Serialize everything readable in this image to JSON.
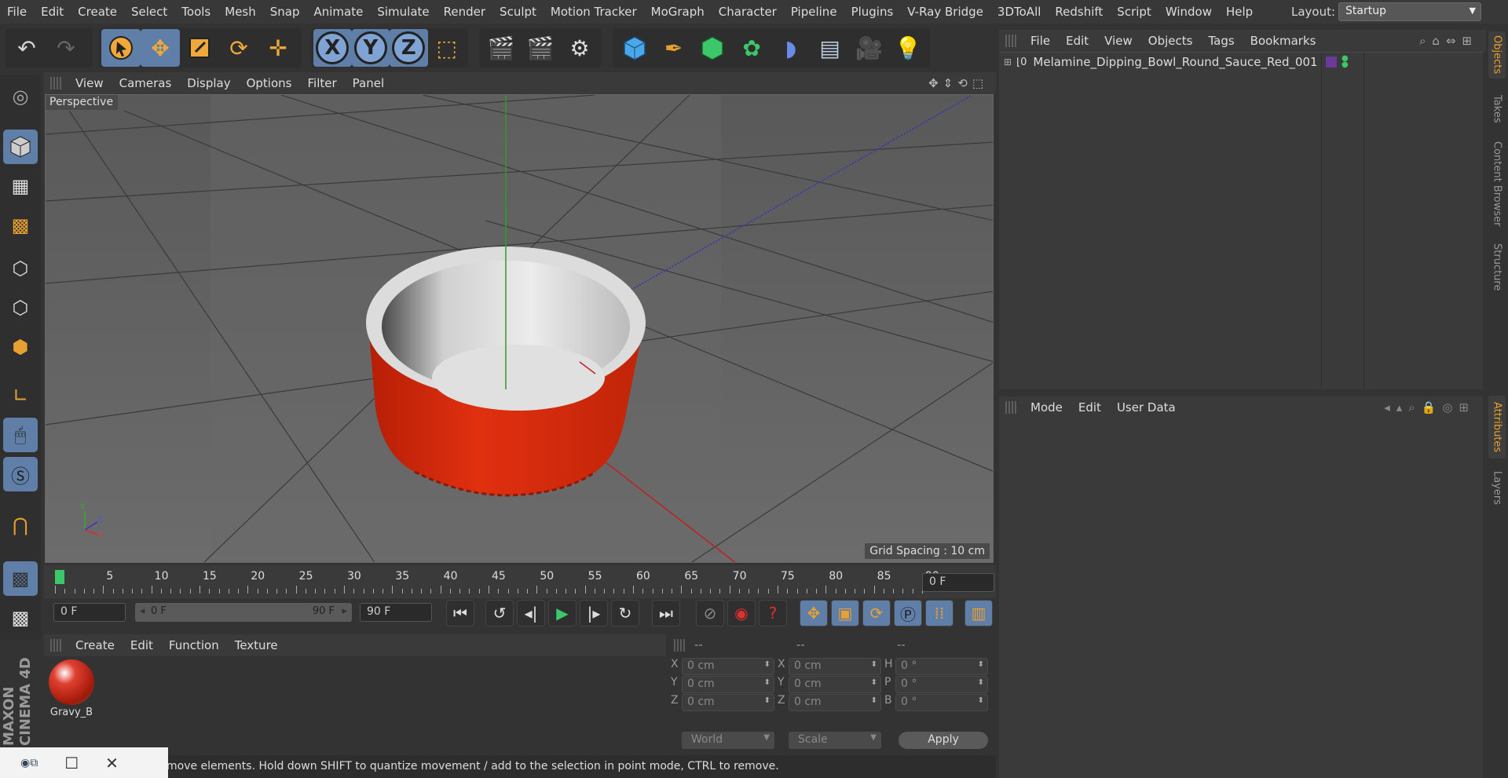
{
  "menubar": {
    "items": [
      "File",
      "Edit",
      "Create",
      "Select",
      "Tools",
      "Mesh",
      "Snap",
      "Animate",
      "Simulate",
      "Render",
      "Sculpt",
      "Motion Tracker",
      "MoGraph",
      "Character",
      "Pipeline",
      "Plugins",
      "V-Ray Bridge",
      "3DToAll",
      "Redshift",
      "Script",
      "Window",
      "Help"
    ],
    "layout_label": "Layout:",
    "layout_value": "Startup"
  },
  "viewport": {
    "menu": [
      "View",
      "Cameras",
      "Display",
      "Options",
      "Filter",
      "Panel"
    ],
    "label": "Perspective",
    "grid_spacing": "Grid Spacing : 10 cm",
    "axis_y": "Y",
    "axis_z": "Z",
    "axis_x": "X"
  },
  "timeline": {
    "ticks": [
      "0",
      "5",
      "10",
      "15",
      "20",
      "25",
      "30",
      "35",
      "40",
      "45",
      "50",
      "55",
      "60",
      "65",
      "70",
      "75",
      "80",
      "85",
      "90"
    ],
    "current_frame": "0 F",
    "start_frame": "0 F",
    "range_start": "0 F",
    "range_end": "90 F",
    "end_frame": "90 F"
  },
  "materials": {
    "menu": [
      "Create",
      "Edit",
      "Function",
      "Texture"
    ],
    "items": [
      {
        "name": "Gravy_B"
      }
    ]
  },
  "coordinates": {
    "headers": [
      "--",
      "--",
      "--"
    ],
    "rows": [
      {
        "a": "X",
        "v1": "0 cm",
        "b": "X",
        "v2": "0 cm",
        "c": "H",
        "v3": "0 °"
      },
      {
        "a": "Y",
        "v1": "0 cm",
        "b": "Y",
        "v2": "0 cm",
        "c": "P",
        "v3": "0 °"
      },
      {
        "a": "Z",
        "v1": "0 cm",
        "b": "Z",
        "v2": "0 cm",
        "c": "B",
        "v3": "0 °"
      }
    ],
    "mode_world": "World",
    "mode_scale": "Scale",
    "apply": "Apply"
  },
  "status_text": "move elements. Hold down SHIFT to quantize movement / add to the selection in point mode, CTRL to remove.",
  "objects": {
    "menu": [
      "File",
      "Edit",
      "View",
      "Objects",
      "Tags",
      "Bookmarks"
    ],
    "items": [
      {
        "name": "Melamine_Dipping_Bowl_Round_Sauce_Red_001"
      }
    ]
  },
  "attributes": {
    "menu": [
      "Mode",
      "Edit",
      "User Data"
    ]
  },
  "side_tabs": [
    "Objects",
    "Takes",
    "Content Browser",
    "Structure",
    "Attributes",
    "Layers"
  ],
  "brand": "MAXON CINEMA 4D",
  "colors": {
    "accent": "#e8a030",
    "selected": "#5f7fa8",
    "bowl_red": "#d42a0a"
  }
}
